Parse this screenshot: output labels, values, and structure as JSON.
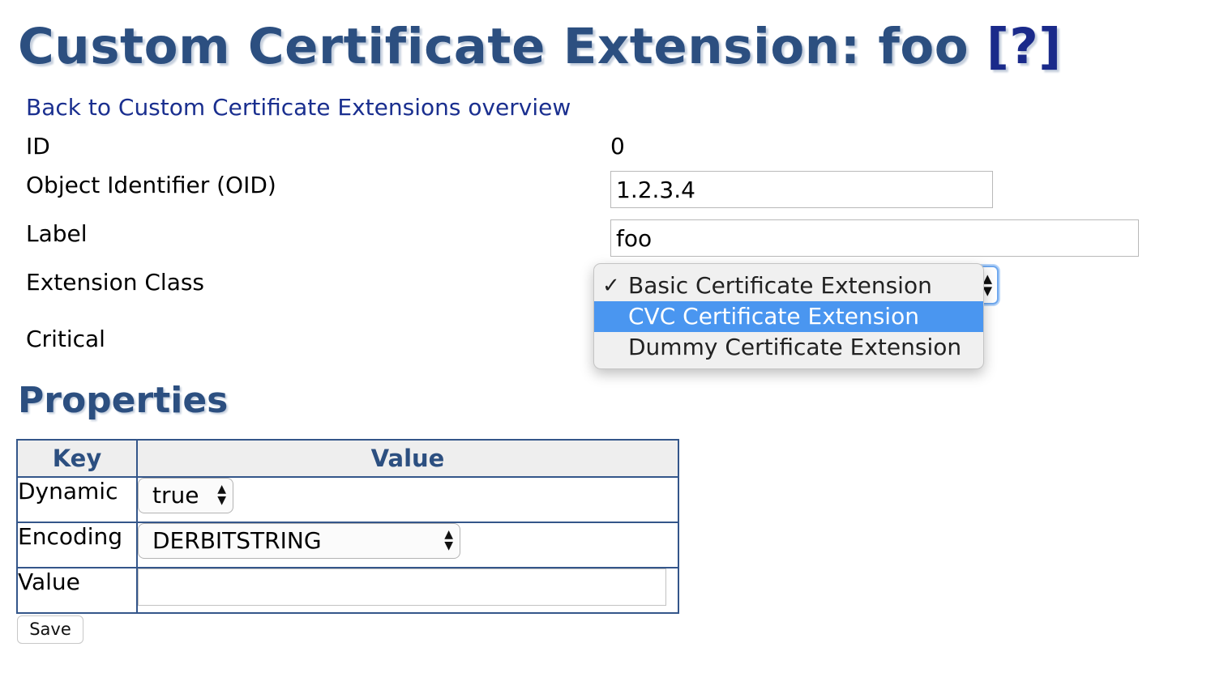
{
  "header": {
    "title": "Custom Certificate Extension: foo",
    "help": "[?]"
  },
  "back_link": "Back to Custom Certificate Extensions overview",
  "form": {
    "id_label": "ID",
    "id_value": "0",
    "oid_label": "Object Identifier (OID)",
    "oid_value": "1.2.3.4",
    "label_label": "Label",
    "label_value": "foo",
    "extension_class_label": "Extension Class",
    "critical_label": "Critical",
    "extension_class_options": [
      {
        "label": "Basic Certificate Extension",
        "checked": true
      },
      {
        "label": "CVC Certificate Extension",
        "highlighted": true
      },
      {
        "label": "Dummy Certificate Extension"
      }
    ]
  },
  "properties": {
    "title": "Properties",
    "headers": {
      "key": "Key",
      "value": "Value"
    },
    "rows": [
      {
        "key": "Dynamic",
        "select_value": "true"
      },
      {
        "key": "Encoding",
        "select_value": "DERBITSTRING"
      },
      {
        "key": "Value",
        "input_value": ""
      }
    ]
  },
  "save_label": "Save",
  "icons": {
    "checkmark": "checkmark-icon",
    "select_arrows": "updown-arrows-icon"
  },
  "colors": {
    "heading": "#2c4f80",
    "link": "#1a2f8f",
    "highlight": "#4a96f0",
    "table_border": "#34568a"
  }
}
